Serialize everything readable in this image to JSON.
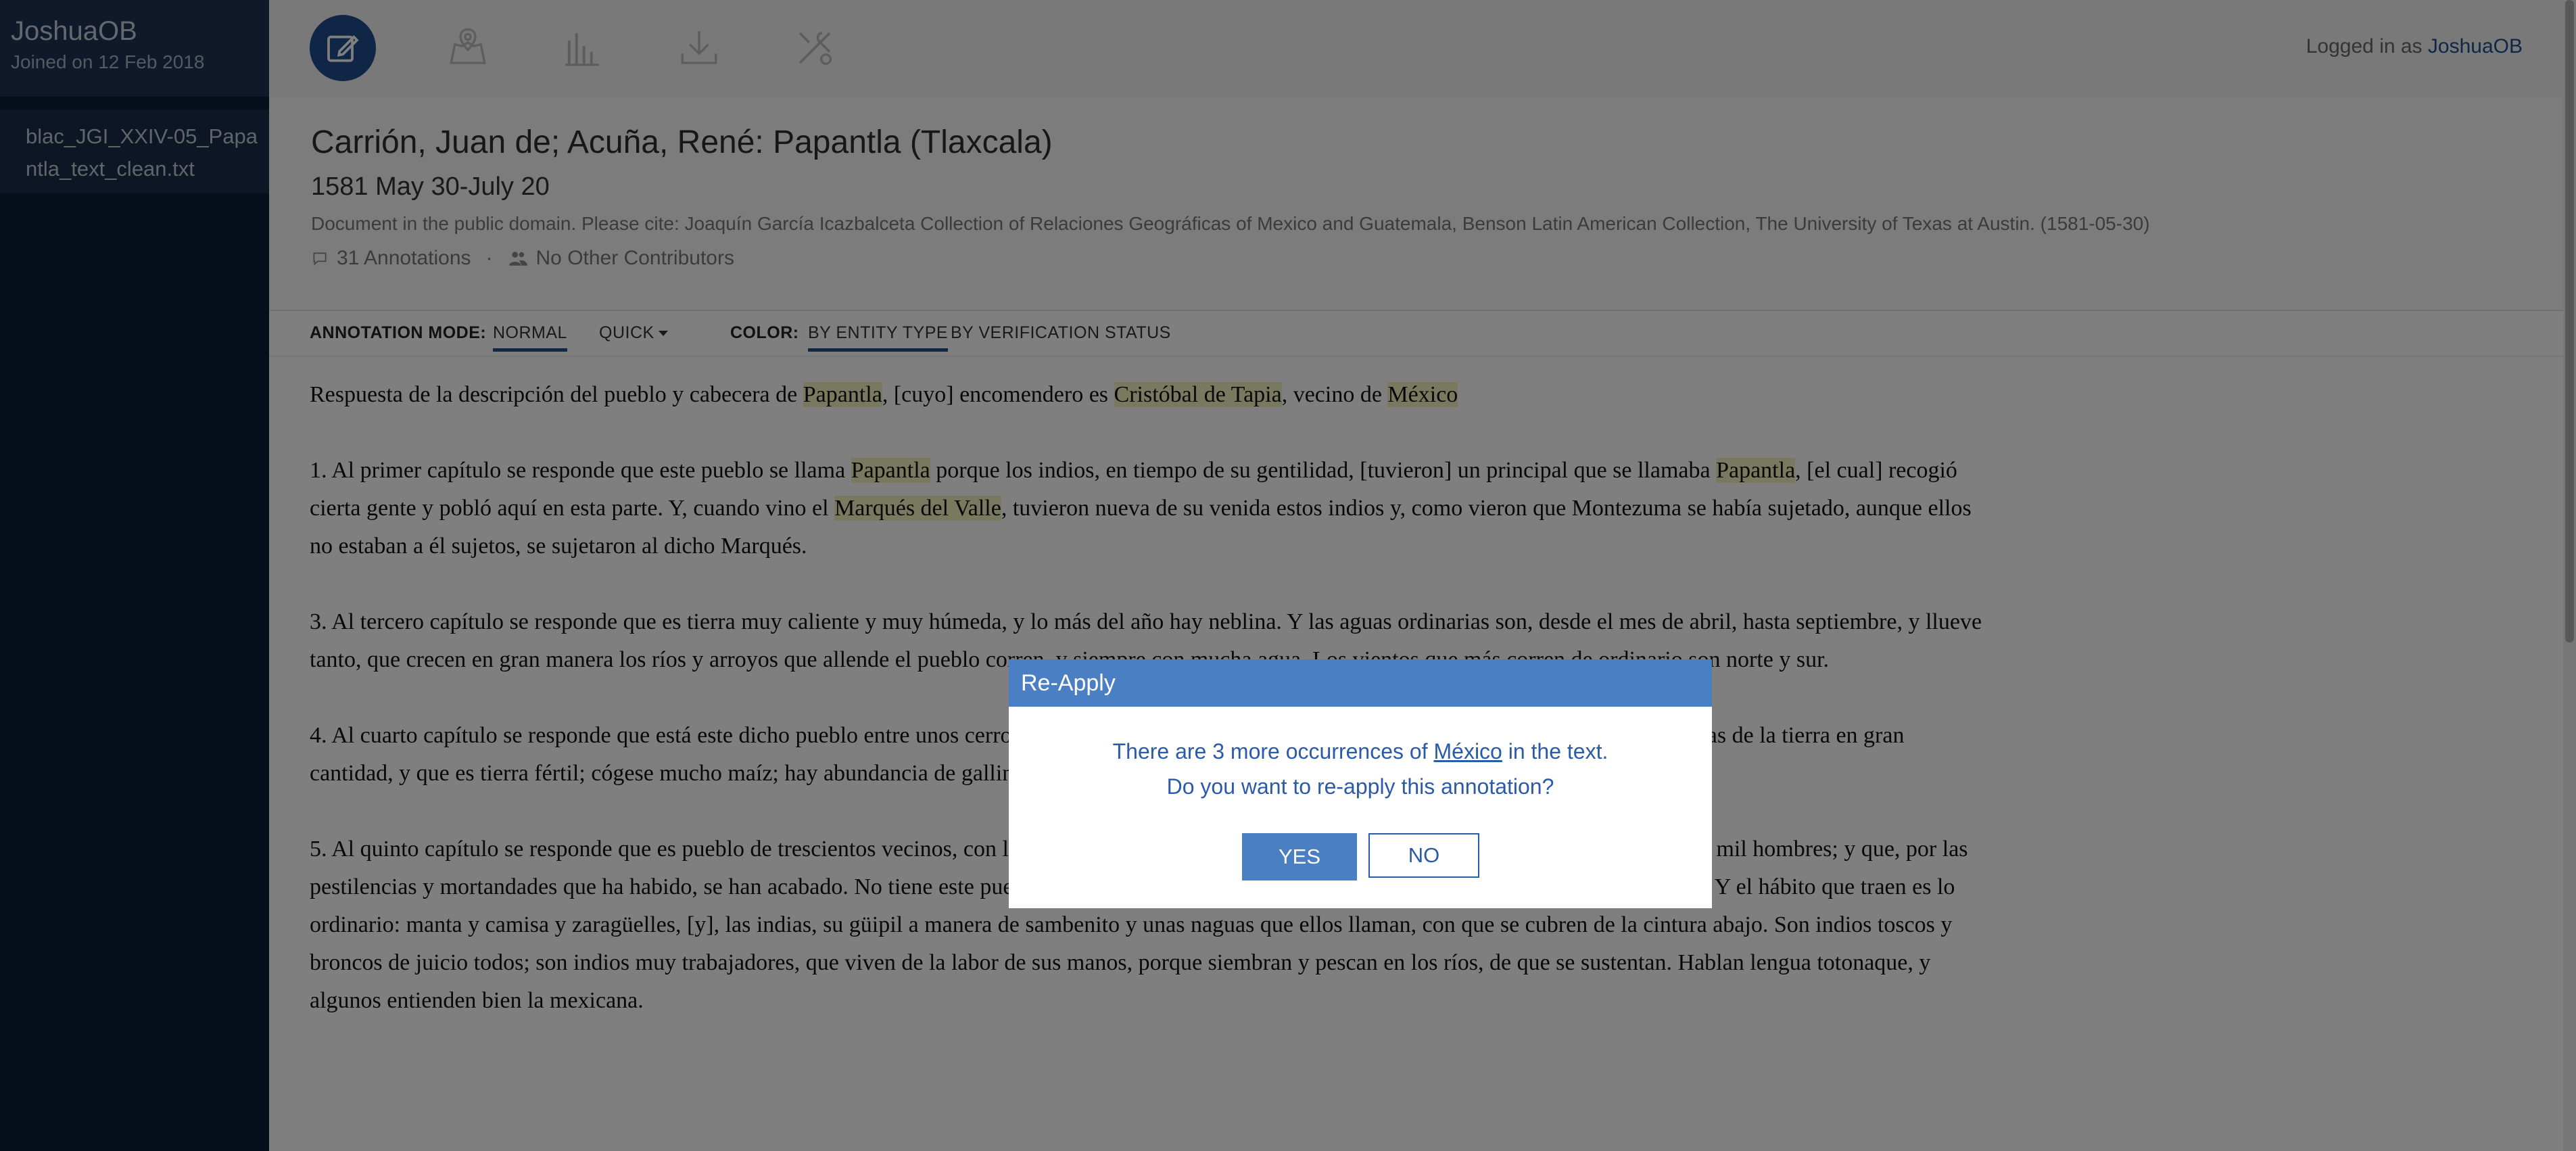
{
  "sidebar": {
    "username": "JoshuaOB",
    "joined": "Joined on 12 Feb 2018",
    "file": "blac_JGI_XXIV-05_Papantla_text_clean.txt"
  },
  "toolbar": {
    "tools": [
      "edit-icon",
      "map-icon",
      "chart-icon",
      "download-icon",
      "tools-icon"
    ],
    "logged_prefix": "Logged in as ",
    "logged_user": "JoshuaOB"
  },
  "doc": {
    "title": "Carrión, Juan de; Acuña, René: Papantla (Tlaxcala)",
    "date": "1581 May 30-July 20",
    "citation": "Document in the public domain. Please cite: Joaquín García Icazbalceta Collection of Relaciones Geográficas of Mexico and Guatemala, Benson Latin American Collection, The University of Texas at Austin. (1581-05-30)",
    "annotations": "31 Annotations",
    "separator": "·",
    "contributors": "No Other Contributors"
  },
  "modes": {
    "annotation_label": "ANNOTATION MODE:",
    "normal": "NORMAL",
    "quick": "QUICK",
    "color_label": "COLOR:",
    "by_entity": "BY ENTITY TYPE",
    "by_verification": "BY VERIFICATION STATUS"
  },
  "content": {
    "p0": [
      {
        "t": "Respuesta de la descripción del pueblo y cabecera de "
      },
      {
        "t": "Papantla",
        "hl": true
      },
      {
        "t": ", [cuyo] encomendero es "
      },
      {
        "t": "Cristóbal de Tapia",
        "hl": true
      },
      {
        "t": ", vecino de "
      },
      {
        "t": "México",
        "hl": true
      }
    ],
    "p1": [
      {
        "t": "1. Al primer capítulo se responde que este pueblo se llama "
      },
      {
        "t": "Papantla",
        "hl": true
      },
      {
        "t": " porque los indios, en tiempo de su gentilidad, [tuvieron] un principal que se llamaba "
      },
      {
        "t": "Papantla",
        "hl": true
      },
      {
        "t": ", [el cual] recogió cierta gente y pobló aquí en esta parte. Y, cuando vino el "
      },
      {
        "t": "Marqués del Valle",
        "hl": true
      },
      {
        "t": ", tuvieron nueva de su venida estos indios y, como vieron que Montezuma se había sujetado, aunque ellos no estaban a él sujetos, se sujetaron al dicho Marqués."
      }
    ],
    "p3": [
      {
        "t": "3. Al tercero capítulo se responde que es tierra muy caliente y muy húmeda, y lo más del año hay neblina. Y las aguas ordinarias son, desde el mes de abril, hasta septiembre, y llueve tanto, que crecen en gran manera los ríos y arroyos que allende el pueblo corren, y siempre con mucha agua. Los vientos que más corren de ordinario son norte y sur."
      }
    ],
    "p4": [
      {
        "t": "4. Al cuarto capítulo se responde que está este dicho pueblo entre unos cerros, y junto a él pasan ríos y arroyos que, en sus riberas, se cogen muchas frutas de la tierra en gran cantidad, y que es tierra fértil; cógese mucho maíz; hay abundancia de gallinas, de Castilla y de la tierra, y hay abundancia de caza."
      }
    ],
    "p5": [
      {
        "t": "5. Al quinto capítulo se responde que es pueblo de trescientos vecinos, con los sujetos, y que, cuando vino el "
      },
      {
        "t": "Marqués del Valle",
        "hl": true
      },
      {
        "t": ", había quince o dieciséis mil hombres; y que, por las pestilencias y mortandades que ha habido, se han acabado. No tiene este pueblo traza, sino que los indios viven lejos unos de otros, en laderas de cerros. Y el hábito que traen es lo ordinario: manta y camisa y zaragüelles, [y], las indias, su güipil a manera de sambenito y unas naguas que ellos llaman, con que se cubren de la cintura abajo. Son indios toscos y broncos de juicio todos; son indios muy trabajadores, que viven de la labor de sus manos, porque siembran y pescan en los ríos, de que se sustentan. Hablan lengua totonaque, y algunos entienden bien la mexicana."
      }
    ]
  },
  "modal": {
    "title": "Re-Apply",
    "line1_pre": "There are 3 more occurrences of ",
    "line1_term": "México",
    "line1_post": " in the text.",
    "line2": "Do you want to re-apply this annotation?",
    "yes": "YES",
    "no": "NO"
  }
}
